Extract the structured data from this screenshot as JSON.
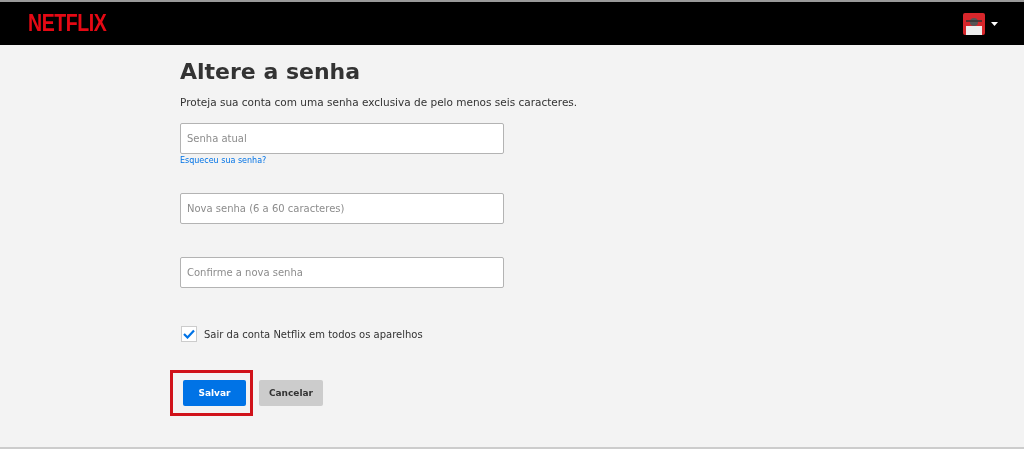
{
  "header": {
    "logo": "NETFLIX"
  },
  "title": "Altere a senha",
  "description": "Proteja sua conta com uma senha exclusiva de pelo menos seis caracteres.",
  "fields": [
    {
      "placeholder": "Senha atual",
      "link": "Esqueceu sua senha?"
    },
    {
      "placeholder": "Nova senha (6 a 60 caracteres)"
    },
    {
      "placeholder": "Confirme a nova senha"
    }
  ],
  "signout": {
    "label": "Sair da conta Netflix em todos os aparelhos",
    "checked": true
  },
  "buttons": [
    {
      "label": "Salvar",
      "kind": "primary",
      "highlighted": true
    },
    {
      "label": "Cancelar",
      "kind": "secondary",
      "highlighted": false
    }
  ]
}
